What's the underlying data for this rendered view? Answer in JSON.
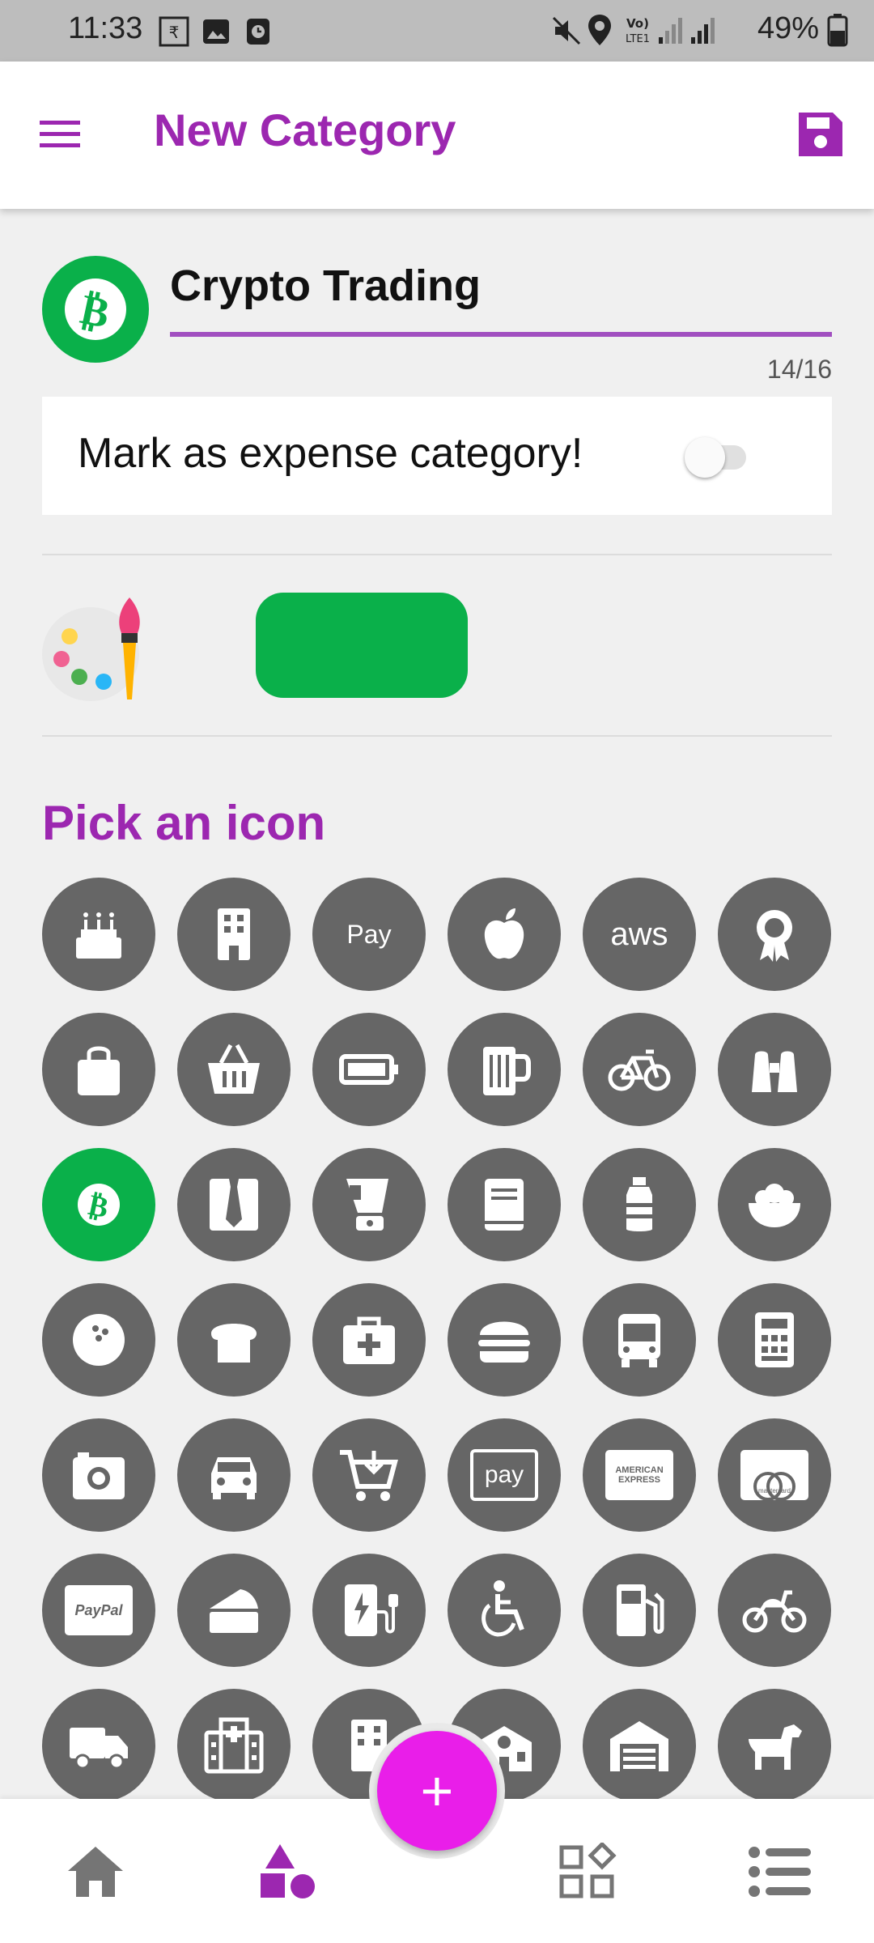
{
  "status_bar": {
    "time": "11:33",
    "battery": "49%"
  },
  "app_bar": {
    "title": "New Category"
  },
  "category": {
    "name": "Crypto Trading",
    "char_count": "14/16",
    "icon": "bitcoin-icon",
    "color": "#0ab04a"
  },
  "expense_toggle": {
    "label": "Mark as expense category!",
    "checked": false
  },
  "color_picker": {
    "icon": "palette-brush-icon",
    "selected_color": "#0ab04a"
  },
  "icon_picker": {
    "title": "Pick an icon",
    "icons": [
      "birthday-cake-icon",
      "building-icon",
      "apple-pay-icon",
      "apple-icon",
      "aws-icon",
      "award-icon",
      "shopping-bag-icon",
      "shopping-basket-icon",
      "battery-icon",
      "beer-mug-icon",
      "bicycle-icon",
      "binoculars-icon",
      "bitcoin-icon",
      "tie-icon",
      "blender-icon",
      "book-icon",
      "bottle-icon",
      "bowl-icon",
      "bowling-ball-icon",
      "bread-icon",
      "first-aid-kit-icon",
      "hamburger-icon",
      "bus-icon",
      "calculator-icon",
      "camera-icon",
      "car-icon",
      "cart-download-icon",
      "amazon-pay-icon",
      "american-express-icon",
      "mastercard-icon",
      "paypal-icon",
      "cheese-icon",
      "charging-station-icon",
      "wheelchair-icon",
      "gas-pump-icon",
      "motorcycle-icon",
      "truck-icon",
      "hospital-icon",
      "office-building-icon",
      "school-icon",
      "garage-icon",
      "dog-icon"
    ],
    "icon_labels": {
      "apple_pay": "Pay",
      "aws": "aws",
      "amazon_pay": "pay",
      "american_express": "AMERICAN EXPRESS",
      "mastercard": "mastercard",
      "paypal": "PayPal"
    },
    "selected": "bitcoin-icon"
  },
  "bottom_nav": {
    "items": [
      "home-icon",
      "shapes-icon",
      "grid-icon",
      "list-icon"
    ],
    "active": "shapes-icon",
    "fab_symbol": "+"
  },
  "colors": {
    "accent": "#9c27b0",
    "fab": "#e91ee9",
    "selected_icon": "#0ab04a",
    "icon_bg": "#666666"
  }
}
